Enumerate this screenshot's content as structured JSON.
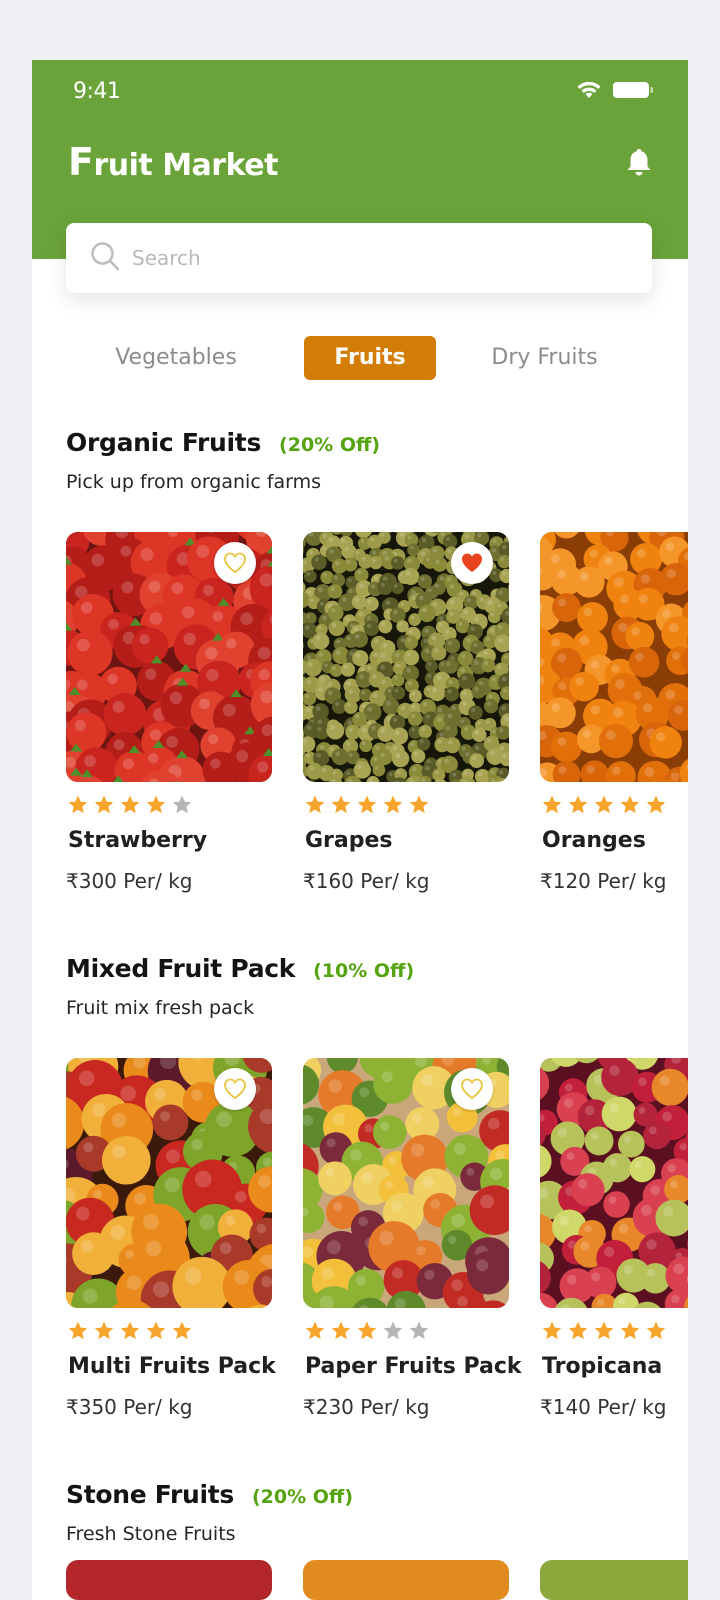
{
  "status_bar": {
    "time": "9:41"
  },
  "header": {
    "title_first": "F",
    "title_rest": "ruit Market"
  },
  "search": {
    "placeholder": "Search"
  },
  "tabs": [
    {
      "label": "Vegetables",
      "active": false
    },
    {
      "label": "Fruits",
      "active": true
    },
    {
      "label": "Dry Fruits",
      "active": false
    }
  ],
  "colors": {
    "header_bg": "#6aa33a",
    "active_tab": "#d27d06",
    "discount": "#55a30f",
    "star_on": "#f7a42c",
    "star_off": "#b5b5b5",
    "fav_active": "#e8431f",
    "fav_inactive": "#e9c43e"
  },
  "sections": [
    {
      "title": "Organic Fruits",
      "discount": "(20% Off)",
      "subtitle": "Pick up from organic farms",
      "products": [
        {
          "name": "Strawberry",
          "price": "₹300 Per/ kg",
          "rating": 4,
          "favorite": false,
          "image": "strawberries"
        },
        {
          "name": "Grapes",
          "price": "₹160 Per/ kg",
          "rating": 5,
          "favorite": true,
          "image": "grapes"
        },
        {
          "name": "Oranges",
          "price": "₹120 Per/ kg",
          "rating": 5,
          "favorite": false,
          "image": "oranges"
        }
      ]
    },
    {
      "title": "Mixed Fruit Pack",
      "discount": "(10% Off)",
      "subtitle": "Fruit mix fresh pack",
      "products": [
        {
          "name": "Multi Fruits Pack",
          "price": "₹350 Per/ kg",
          "rating": 5,
          "favorite": false,
          "image": "mixed-fruits"
        },
        {
          "name": "Paper Fruits Pack",
          "price": "₹230 Per/ kg",
          "rating": 3,
          "favorite": false,
          "image": "fruit-box"
        },
        {
          "name": "Tropicana",
          "price": "₹140 Per/ kg",
          "rating": 5,
          "favorite": false,
          "image": "tropical-mix"
        }
      ]
    },
    {
      "title": "Stone Fruits",
      "discount": "(20% Off)",
      "subtitle": "Fresh Stone Fruits",
      "products": []
    }
  ]
}
